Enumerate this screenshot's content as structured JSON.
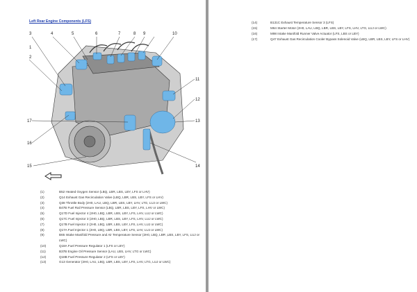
{
  "title": "Left Rear Engine Components (LFS)",
  "callouts": [
    "1",
    "2",
    "3",
    "4",
    "5",
    "6",
    "7",
    "8",
    "9",
    "10",
    "11",
    "12",
    "13",
    "14",
    "15",
    "16",
    "17"
  ],
  "legend_left": [
    {
      "num": "(1)",
      "text": "B52 Heated Oxygen Sensor (LBQ, LBR, LBS, LBY, LFS or LHV)"
    },
    {
      "num": "(2)",
      "text": "Q14 Exhaust Gas Recirculation Valve (LBQ, LBR, LBS, LBY, LFS or LHV)"
    },
    {
      "num": "(3)",
      "text": "Q38 Throttle Body (2H0, LAU, LBQ, LBR, LBS, LBY, LHV, LTG, LUJ or LWC)"
    },
    {
      "num": "(4)",
      "text": "B47B Fuel Rail Pressure Sensor (LBQ, LBR, LBS, LBY, LFS, LHV or LWC)"
    },
    {
      "num": "(5)",
      "text": "Q17D Fuel Injector 4 (2H0, LBQ, LBR, LBS, LBY, LFS, LHV, LUJ or LWC)"
    },
    {
      "num": "(6)",
      "text": "Q17C Fuel Injector 3 (2H0, LBQ, LBR, LBS, LBY, LFS, LHV, LUJ or LWC)"
    },
    {
      "num": "(7)",
      "text": "Q17B Fuel Injector 2 (2H0, LBQ, LBR, LBS, LBY, LFS, LHV, LUJ or LWC)"
    },
    {
      "num": "(8)",
      "text": "Q17A Fuel Injector 1 (2H0, LBQ, LBR, LBS, LBY, LFS, LHV, LUJ or LWC)"
    },
    {
      "num": "(9)",
      "text": "B65 Intake Manifold Pressure and Air Temperature Sensor (2H0, LBQ, LBR ,LBS, LBY, LFS, LUJ or LWC)"
    },
    {
      "num": "(10)",
      "text": "Q18A Fuel Pressure Regulator 1 (LFS or LBY)"
    },
    {
      "num": "(11)",
      "text": "B37B Engine Oil Pressure Sensor (LAU, LBS, LHV, LTG or LWC)"
    },
    {
      "num": "(12)",
      "text": "Q18B Fuel Pressure Regulator 2 (LFS or LBY)"
    },
    {
      "num": "(13)",
      "text": "G13 Generator (2H0, LAU, LBQ, LBR, LBS, LBY, LFS, LHV, LTG, LUJ or LWC)"
    }
  ],
  "legend_right": [
    {
      "num": "(14)",
      "text": "B131C Exhaust Temperature Sensor 3 (LFS)"
    },
    {
      "num": "(15)",
      "text": "M64 Starter Motor (2H0, LAU, LBQ, LBR, LBS, LBY, LFS, LHV, LTG, LUJ or LWC)"
    },
    {
      "num": "(16)",
      "text": "M98 Intake Manifold Runner Valve Actuator (LFS, LBS or LBY)"
    },
    {
      "num": "(17)",
      "text": "Q47 Exhaust Gas Recirculation Cooler Bypass Solenoid Valve (LBQ, LBR, LBS, LBY, LFS or LHV)"
    }
  ],
  "colors": {
    "highlight": "#6fb6e8",
    "title": "#1f3fae",
    "engine": "#5a5a5a"
  }
}
